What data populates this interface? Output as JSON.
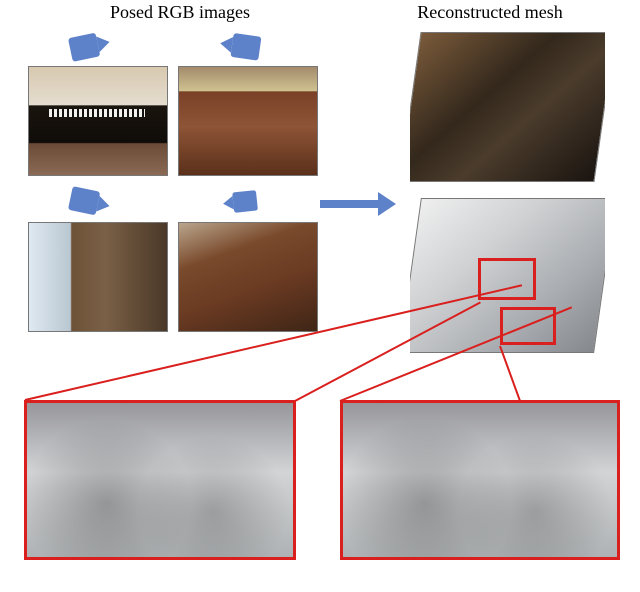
{
  "headings": {
    "left": "Posed RGB images",
    "right": "Reconstructed mesh"
  },
  "icons": {
    "camera": "camera-icon"
  },
  "thumbnails": {
    "tl": "piano-room-photo",
    "tr": "brown-sofa-photo",
    "bl": "room-window-desk-photo",
    "br": "sofa-closeup-photo"
  },
  "meshes": {
    "textured": "reconstructed-textured-mesh",
    "geometry": "reconstructed-geometry-mesh"
  },
  "details": {
    "left": "mesh-detail-desk-area",
    "right": "mesh-detail-piano-sofa"
  },
  "caption": ""
}
